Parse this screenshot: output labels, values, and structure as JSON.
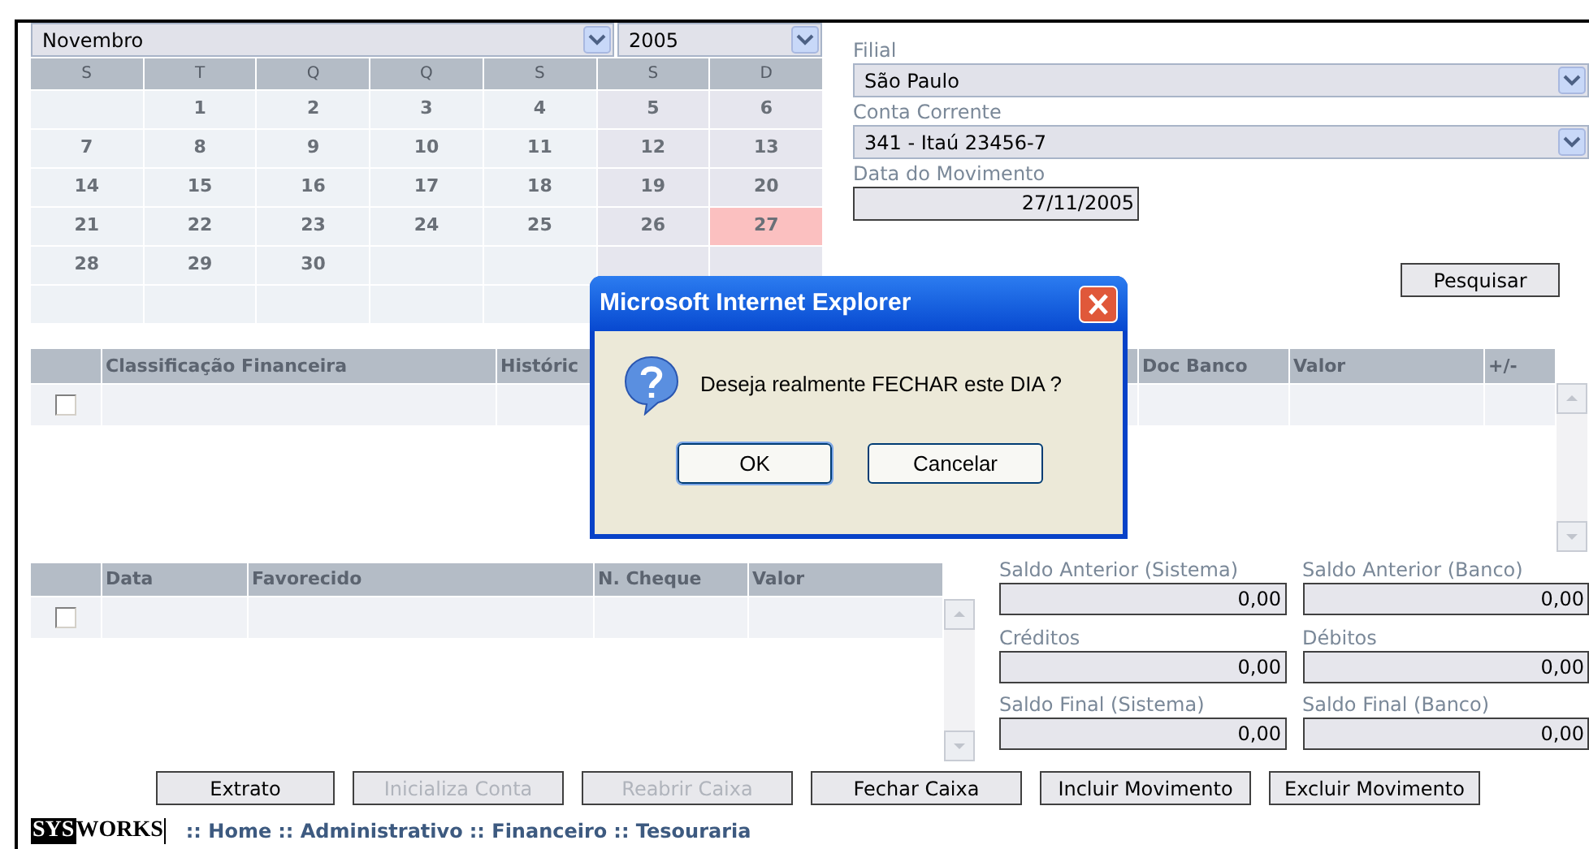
{
  "calendar": {
    "month": "Novembro",
    "year": "2005",
    "weekdays": [
      "S",
      "T",
      "Q",
      "Q",
      "S",
      "S",
      "D"
    ],
    "weeks": [
      [
        {
          "day": "1",
          "selected": false
        },
        {
          "day": "2",
          "selected": false
        },
        {
          "day": "3",
          "selected": false
        },
        {
          "day": "4",
          "selected": false
        },
        {
          "day": "5",
          "selected": false
        },
        {
          "day": "6",
          "selected": false
        }
      ],
      [
        {
          "day": "7",
          "selected": false
        },
        {
          "day": "8",
          "selected": false
        },
        {
          "day": "9",
          "selected": false
        },
        {
          "day": "10",
          "selected": false
        },
        {
          "day": "11",
          "selected": false
        },
        {
          "day": "12",
          "selected": false
        },
        {
          "day": "13",
          "selected": false
        }
      ],
      [
        {
          "day": "14",
          "selected": false
        },
        {
          "day": "15",
          "selected": false
        },
        {
          "day": "16",
          "selected": false
        },
        {
          "day": "17",
          "selected": false
        },
        {
          "day": "18",
          "selected": false
        },
        {
          "day": "19",
          "selected": false
        },
        {
          "day": "20",
          "selected": false
        }
      ],
      [
        {
          "day": "21",
          "selected": false
        },
        {
          "day": "22",
          "selected": false
        },
        {
          "day": "23",
          "selected": false
        },
        {
          "day": "24",
          "selected": false
        },
        {
          "day": "25",
          "selected": false
        },
        {
          "day": "26",
          "selected": false
        },
        {
          "day": "27",
          "selected": true
        }
      ],
      [
        {
          "day": "28",
          "selected": false
        },
        {
          "day": "29",
          "selected": false
        },
        {
          "day": "30",
          "selected": false
        }
      ]
    ]
  },
  "fields": [
    {
      "label": "Filial",
      "value": "São Paulo",
      "kind": "select"
    },
    {
      "label": "Conta Corrente",
      "value": "341 - Itaú 23456-7",
      "kind": "select"
    },
    {
      "label": "Data do Movimento",
      "value": "27/11/2005",
      "kind": "date"
    }
  ],
  "search_button": "Pesquisar",
  "movements_table": {
    "columns": [
      "Classificação Financeira",
      "Históric",
      "Doc Banco",
      "Valor",
      "+/-"
    ],
    "rows": [
      {
        "checked": false
      }
    ]
  },
  "checks_table": {
    "columns": [
      "Data",
      "Favorecido",
      "N. Cheque",
      "Valor"
    ],
    "rows": [
      {
        "checked": false
      }
    ]
  },
  "balances": [
    {
      "label": "Saldo Anterior (Sistema)",
      "value": "0,00"
    },
    {
      "label": "Saldo Anterior (Banco)",
      "value": "0,00"
    },
    {
      "label": "Créditos",
      "value": "0,00"
    },
    {
      "label": "Débitos",
      "value": "0,00"
    },
    {
      "label": "Saldo Final (Sistema)",
      "value": "0,00"
    },
    {
      "label": "Saldo Final (Banco)",
      "value": "0,00"
    }
  ],
  "buttons": [
    {
      "label": "Extrato",
      "disabled": false
    },
    {
      "label": "Inicializa Conta",
      "disabled": true
    },
    {
      "label": "Reabrir Caixa",
      "disabled": true
    },
    {
      "label": "Fechar Caixa",
      "disabled": false
    },
    {
      "label": "Incluir Movimento",
      "disabled": false
    },
    {
      "label": "Excluir Movimento",
      "disabled": false
    }
  ],
  "footer": {
    "logo": [
      "SYS",
      "WORKS"
    ],
    "separator": "::",
    "breadcrumb": [
      "Home",
      "Administrativo",
      "Financeiro",
      "Tesouraria"
    ]
  },
  "dialog": {
    "title": "Microsoft Internet Explorer",
    "message": "Deseja realmente FECHAR este DIA ?",
    "buttons": [
      "OK",
      "Cancelar"
    ]
  }
}
